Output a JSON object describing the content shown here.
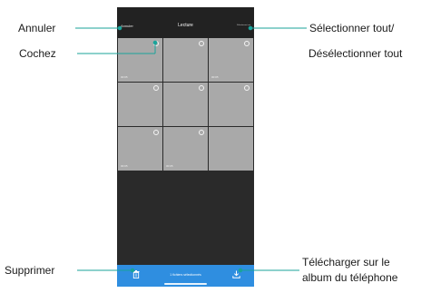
{
  "app": {
    "topbar": {
      "cancel_label": "Annuler",
      "title": "Lecture",
      "select_all_label": "Sélectionner tout"
    },
    "grid": {
      "tiles": [
        {
          "duration": "00:05",
          "has_checkbox": true
        },
        {
          "duration": "",
          "has_checkbox": true
        },
        {
          "duration": "00:05",
          "has_checkbox": true
        },
        {
          "duration": "",
          "has_checkbox": true
        },
        {
          "duration": "",
          "has_checkbox": true
        },
        {
          "duration": "",
          "has_checkbox": true
        },
        {
          "duration": "00:05",
          "has_checkbox": true
        },
        {
          "duration": "00:05",
          "has_checkbox": true
        },
        {
          "duration": "",
          "has_checkbox": false
        }
      ]
    },
    "bottombar": {
      "selected_text": "1 fichiers sélectionnés",
      "trash_icon": "trash-icon",
      "download_icon": "download-icon"
    }
  },
  "callouts": {
    "annuler": "Annuler",
    "cochez": "Cochez",
    "select_all": "Sélectionner tout/",
    "deselect_all": "Désélectionner tout",
    "supprimer": "Supprimer",
    "download_line1": "Télécharger sur le",
    "download_line2": "album du téléphone"
  },
  "colors": {
    "accent": "#2f8ee0",
    "callout_line": "#1aa39a",
    "screen_bg": "#2a2a2a",
    "tile": "#a9a9a9"
  }
}
